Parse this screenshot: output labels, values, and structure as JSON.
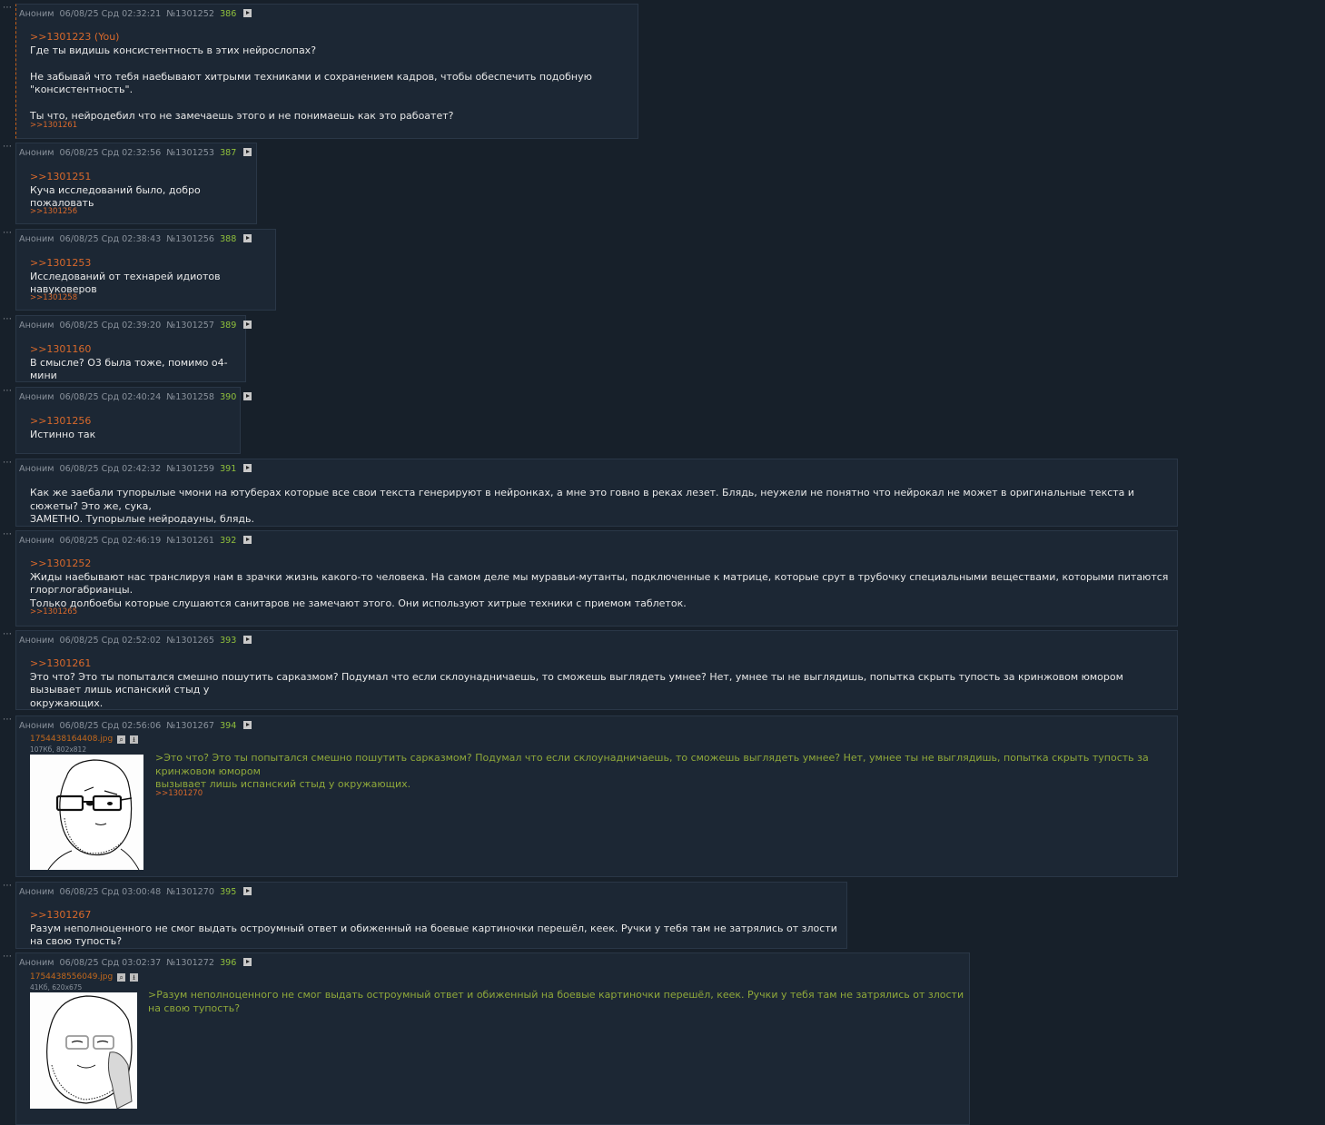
{
  "posts": [
    {
      "author": "Аноним",
      "date": "06/08/25 Срд 02:32:21",
      "no": "№1301252",
      "num": "386",
      "ref": ">>1301223 (You)",
      "lines": [
        "Где ты видишь консистентность в этих нейрослопах?",
        "",
        "Не забывай что тебя наебывают хитрыми техниками и сохранением кадров, чтобы обеспечить подобную \"консистентность\".",
        "",
        "Ты что, нейродебил что не замечаешь этого и не понимаешь как это рабоатет?"
      ],
      "backref": ">>1301261"
    },
    {
      "author": "Аноним",
      "date": "06/08/25 Срд 02:32:56",
      "no": "№1301253",
      "num": "387",
      "ref": ">>1301251",
      "lines": [
        "Куча исследований было, добро пожаловать"
      ],
      "backref": ">>1301256"
    },
    {
      "author": "Аноним",
      "date": "06/08/25 Срд 02:38:43",
      "no": "№1301256",
      "num": "388",
      "ref": ">>1301253",
      "lines": [
        "Исследований от технарей идиотов навуковеров"
      ],
      "backref": ">>1301258"
    },
    {
      "author": "Аноним",
      "date": "06/08/25 Срд 02:39:20",
      "no": "№1301257",
      "num": "389",
      "ref": ">>1301160",
      "lines": [
        "В смысле? О3 была тоже, помимо о4-мини"
      ]
    },
    {
      "author": "Аноним",
      "date": "06/08/25 Срд 02:40:24",
      "no": "№1301258",
      "num": "390",
      "ref": ">>1301256",
      "lines": [
        "Истинно так"
      ]
    },
    {
      "author": "Аноним",
      "date": "06/08/25 Срд 02:42:32",
      "no": "№1301259",
      "num": "391",
      "lines": [
        "Как же заебали тупорылые чмони на ютуберах которые все свои текста генерируют в нейронках, а мне это говно в реках лезет. Блядь, неужели не понятно что нейрокал не может в оригинальные текста и сюжеты? Это же, сука,",
        "ЗАМЕТНО. Тупорылые нейродауны, блядь."
      ]
    },
    {
      "author": "Аноним",
      "date": "06/08/25 Срд 02:46:19",
      "no": "№1301261",
      "num": "392",
      "ref": ">>1301252",
      "lines": [
        "Жиды наебывают нас транслируя нам в зрачки жизнь какого-то человека. На самом деле мы муравьи-мутанты, подключенные к матрице, которые срут в трубочку специальными веществами, которыми питаются глорглогабрианцы.",
        "Только долбоебы которые слушаются санитаров не замечают этого. Они используют хитрые техники с приемом таблеток."
      ],
      "backref": ">>1301265"
    },
    {
      "author": "Аноним",
      "date": "06/08/25 Срд 02:52:02",
      "no": "№1301265",
      "num": "393",
      "ref": ">>1301261",
      "lines": [
        "Это что? Это ты попытался смешно пошутить сарказмом? Подумал что если склоунадничаешь, то сможешь выглядеть умнее? Нет, умнее ты не выглядишь, попытка скрыть тупость за кринжовом юмором вызывает лишь испанский стыд у",
        "окружающих."
      ]
    },
    {
      "author": "Аноним",
      "date": "06/08/25 Срд 02:56:06",
      "no": "№1301267",
      "num": "394",
      "file": "1754438164408.jpg",
      "filemeta": "107Кб, 802x812",
      "quote": [
        ">Это что? Это ты попытался смешно пошутить сарказмом? Подумал что если склоунадничаешь, то сможешь выглядеть умнее? Нет, умнее ты не выглядишь, попытка скрыть тупость за кринжовом юмором",
        "вызывает лишь испанский стыд у окружающих."
      ],
      "backref": ">>1301270"
    },
    {
      "author": "Аноним",
      "date": "06/08/25 Срд 03:00:48",
      "no": "№1301270",
      "num": "395",
      "ref": ">>1301267",
      "lines": [
        "Разум неполноценного не смог выдать остроумный ответ и обиженный на боевые картиночки перешёл, кеек. Ручки у тебя там не затрялись от злости на свою тупость?"
      ]
    },
    {
      "author": "Аноним",
      "date": "06/08/25 Срд 03:02:37",
      "no": "№1301272",
      "num": "396",
      "file": "1754438556049.jpg",
      "filemeta": "41Кб, 620x675",
      "quote": [
        ">Разум неполноценного не смог выдать остроумный ответ и обиженный на боевые картиночки перешёл, кеек. Ручки у тебя там не затрялись от злости на свою тупость?"
      ]
    }
  ],
  "colors": {
    "bg": "#17202a",
    "post": "#1c2734",
    "ref": "#d9692b",
    "quote": "#8fa83a",
    "num": "#8fbf3c"
  },
  "icons": {
    "dots": "ellipsis-icon",
    "play": "play-icon",
    "zoom": "search-icon",
    "download": "download-icon"
  }
}
